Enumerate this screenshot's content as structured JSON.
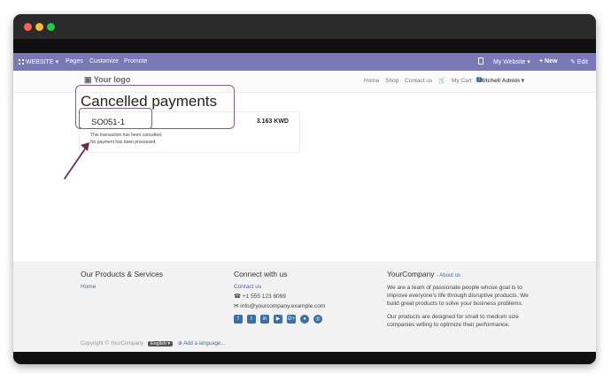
{
  "adminbar": {
    "website_label": "WEBSITE",
    "menu_items": [
      "Pages",
      "Customize",
      "Promote"
    ],
    "my_website_label": "My Website",
    "new_label": "+ New",
    "edit_label": "Edit"
  },
  "sitenav": {
    "logo_text": "Your logo",
    "links": [
      "Home",
      "Shop",
      "Contact us"
    ],
    "cart_label": "My Cart",
    "cart_count": "1",
    "user_name": "Mitchell Admin"
  },
  "main": {
    "title": "Cancelled payments",
    "order_ref": "SO051-1",
    "amount": "3.163 KWD",
    "message_cancelled": "This transaction has been cancelled.",
    "message_no_payment": "No payment has been processed."
  },
  "footer": {
    "col1": {
      "heading": "Our Products & Services",
      "link": "Home"
    },
    "col2": {
      "heading": "Connect with us",
      "contact_link": "Contact us",
      "phone": "+1 555 123 8069",
      "email": "info@yourcompany.example.com",
      "social_icons": [
        "facebook-icon",
        "twitter-icon",
        "linkedin-icon",
        "youtube-icon",
        "google-plus-icon",
        "github-icon",
        "instagram-icon"
      ]
    },
    "col3": {
      "heading": "YourCompany",
      "about_link": "- About us",
      "para1": "We are a team of passionate people whose goal is to improve everyone's life through disruptive products. We build great products to solve your business problems.",
      "para2": "Our products are designed for small to medium size companies willing to optimize their performance."
    },
    "copyright": "Copyright © YourCompany",
    "language": "English",
    "add_language": "Add a language..."
  },
  "colors": {
    "adminbar": "#7a78b5",
    "link": "#3a6ea5",
    "annotation": "#7a5c93"
  }
}
